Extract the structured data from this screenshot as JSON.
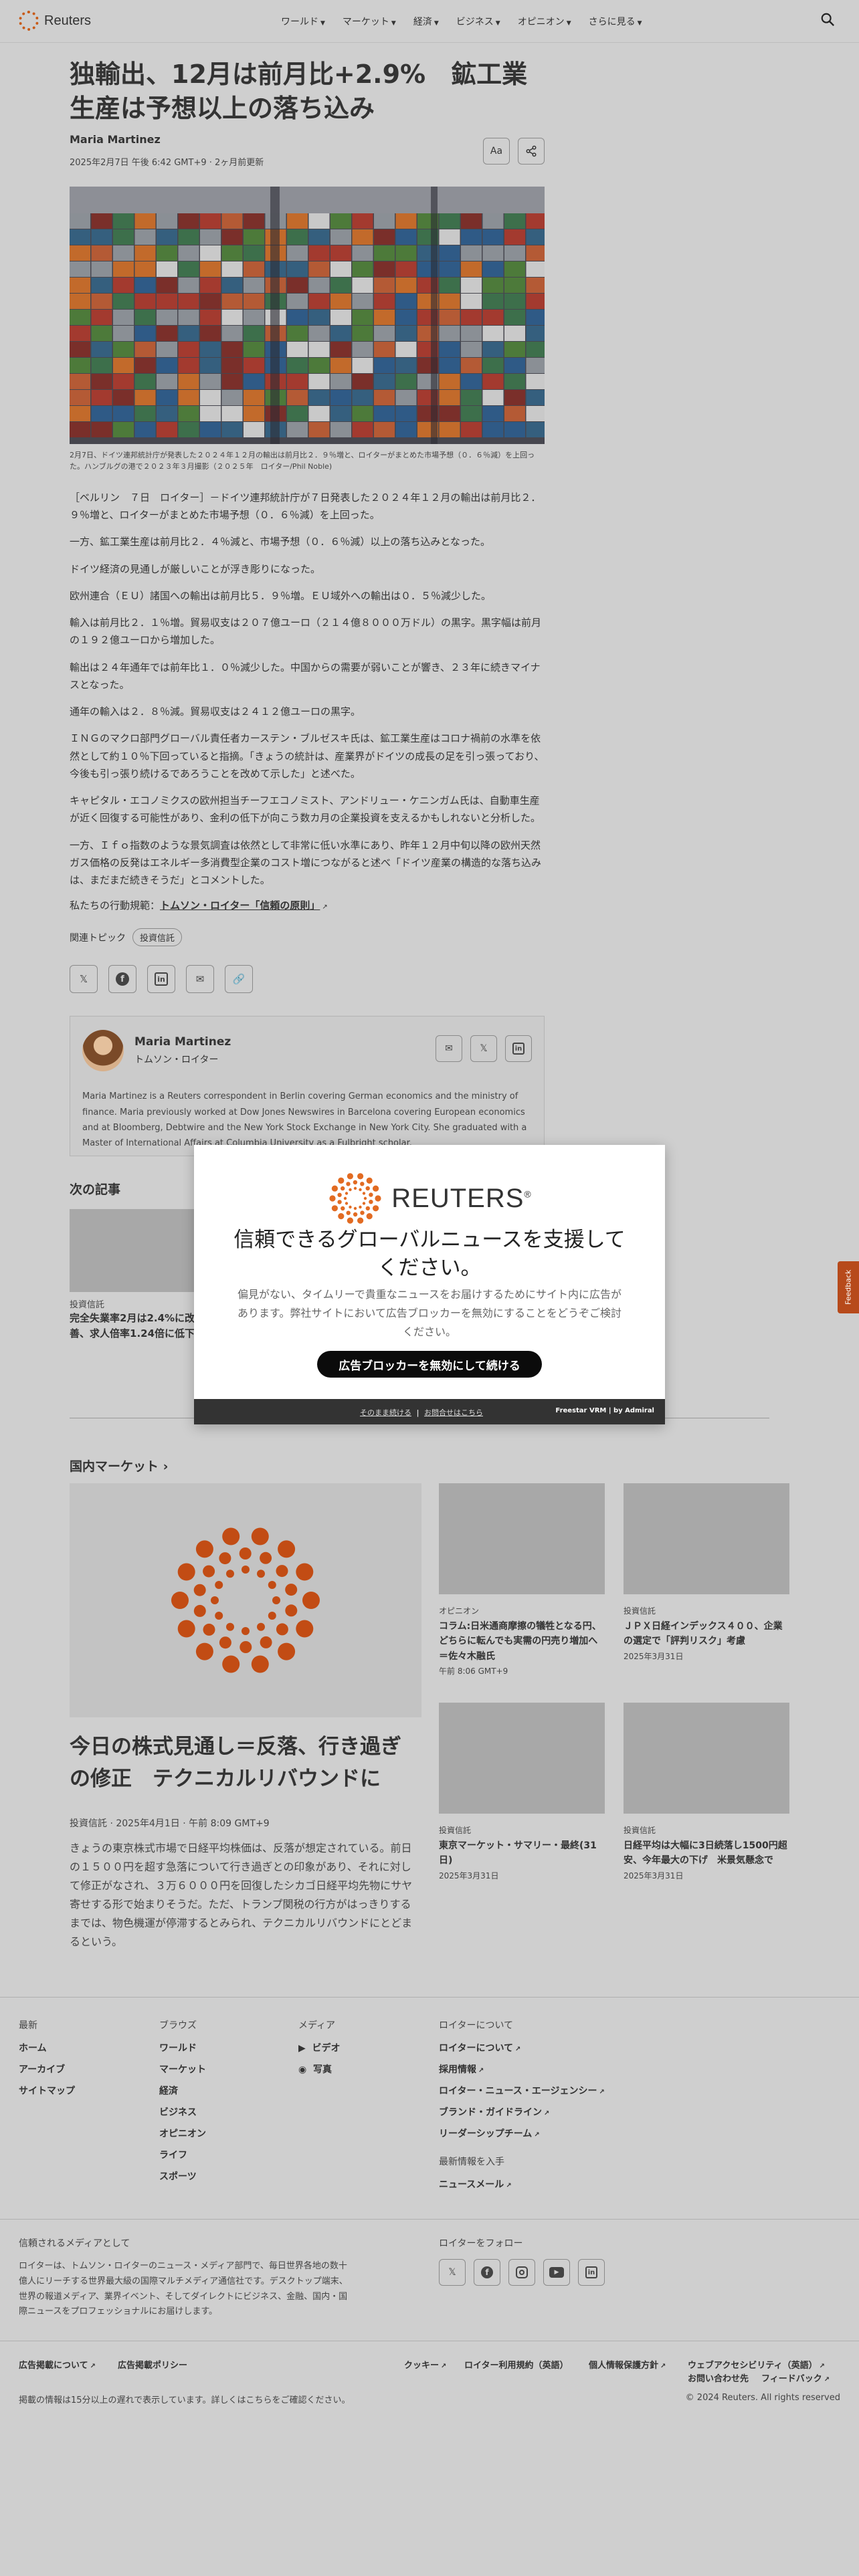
{
  "header": {
    "logo_text": "Reuters",
    "nav": [
      "ワールド",
      "マーケット",
      "経済",
      "ビジネス",
      "オピニオン",
      "さらに見る"
    ]
  },
  "article": {
    "headline": "独輸出、12月は前月比+2.9%　鉱工業生産は予想以上の落ち込み",
    "author": "Maria Martinez",
    "dateline": "2025年2月7日 午後 6:42 GMT+9 · 2ヶ月前更新",
    "text_size_label": "Aa",
    "caption": "2月7日、ドイツ連邦統計庁が発表した２０２４年１２月の輸出は前月比２．９％増と、ロイターがまとめた市場予想（０．６％減）を上回った。ハンブルグの港で２０２３年３月撮影（２０２５年　ロイター/Phil Noble)",
    "paragraphs": [
      "［ベルリン　７日　ロイター］－ドイツ連邦統計庁が７日発表した２０２４年１２月の輸出は前月比２．９％増と、ロイターがまとめた市場予想（０．６％減）を上回った。",
      "一方、鉱工業生産は前月比２．４％減と、市場予想（０．６％減）以上の落ち込みとなった。",
      "ドイツ経済の見通しが厳しいことが浮き彫りになった。",
      "欧州連合（ＥＵ）諸国への輸出は前月比５．９％増。ＥＵ域外への輸出は０．５％減少した。",
      "輸入は前月比２．１％増。貿易収支は２０７億ユーロ（２１４億８０００万ドル）の黒字。黒字幅は前月の１９２億ユーロから増加した。",
      "輸出は２４年通年では前年比１．０％減少した。中国からの需要が弱いことが響き、２３年に続きマイナスとなった。",
      "通年の輸入は２．８％減。貿易収支は２４１２億ユーロの黒字。",
      "ＩＮＧのマクロ部門グローバル責任者カーステン・ブルゼスキ氏は、鉱工業生産はコロナ禍前の水準を依然として約１０％下回っていると指摘。「きょうの統計は、産業界がドイツの成長の足を引っ張っており、今後も引っ張り続けるであろうことを改めて示した」と述べた。",
      "キャピタル・エコノミクスの欧州担当チーフエコノミスト、アンドリュー・ケニンガム氏は、自動車生産が近く回復する可能性があり、金利の低下が向こう数カ月の企業投資を支えるかもしれないと分析した。",
      "一方、Ｉｆｏ指数のような景気調査は依然として非常に低い水準にあり、昨年１２月中旬以降の欧州天然ガス価格の反発はエネルギー多消費型企業のコスト増につながると述べ「ドイツ産業の構造的な落ち込みは、まだまだ続きそうだ」とコメントした。"
    ],
    "principles_prefix": "私たちの行動規範：",
    "principles_link": "トムソン・ロイター「信頼の原則」",
    "topics_label": "関連トピック",
    "topic_chip": "投資信託",
    "author_card": {
      "name": "Maria Martinez",
      "org": "トムソン・ロイター",
      "bio": "Maria Martinez is a Reuters correspondent in Berlin covering German economics and the ministry of finance. Maria previously worked at Dow Jones Newswires in Barcelona covering European economics and at Bloomberg, Debtwire and the New York Stock Exchange in New York City. She graduated with a Master of International Affairs at Columbia University as a Fulbright scholar."
    }
  },
  "next_articles": {
    "title": "次の記事",
    "items": [
      {
        "category": "投資信託",
        "headline": "完全失業率2月は2.4%に改善、求人倍率1.24倍に低下"
      }
    ]
  },
  "domestic_markets": {
    "title": "国内マーケット",
    "main": {
      "headline": "今日の株式見通し＝反落、行き過ぎの修正　テクニカルリバウンドに",
      "meta": "投資信託 · 2025年4月1日 · 午前 8:09 GMT+9",
      "summary": "きょうの東京株式市場で日経平均株価は、反落が想定されている。前日の１５００円を超す急落について行き過ぎとの印象があり、それに対して修正がなされ、３万６０００円を回復したシカゴ日経平均先物にサヤ寄せする形で始まりそうだ。ただ、トランプ関税の行方がはっきりするまでは、物色機運が停滞するとみられ、テクニカルリバウンドにとどまるという。"
    },
    "cards": [
      {
        "category": "オピニオン",
        "title": "コラム:日米通商摩擦の犠牲となる円、どちらに転んでも実需の円売り増加へ＝佐々木融氏",
        "time": "午前 8:06 GMT+9"
      },
      {
        "category": "投資信託",
        "title": "ＪＰＸ日経インデックス４００、企業の選定で「評判リスク」考慮",
        "time": "2025年3月31日"
      },
      {
        "category": "投資信託",
        "title": "東京マーケット・サマリー・最終(31日)",
        "time": "2025年3月31日"
      },
      {
        "category": "投資信託",
        "title": "日経平均は大幅に3日続落し1500円超安、今年最大の下げ　米景気懸念で",
        "time": "2025年3月31日"
      }
    ]
  },
  "footer": {
    "columns": [
      {
        "heading": "最新",
        "items": [
          "ホーム",
          "アーカイブ",
          "サイトマップ"
        ]
      },
      {
        "heading": "ブラウズ",
        "items": [
          "ワールド",
          "マーケット",
          "経済",
          "ビジネス",
          "オピニオン",
          "ライフ",
          "スポーツ"
        ]
      },
      {
        "heading": "メディア",
        "items": [
          "ビデオ",
          "写真"
        ]
      },
      {
        "heading": "ロイターについて",
        "items": [
          "ロイターについて",
          "採用情報",
          "ロイター・ニュース・エージェンシー",
          "ブランド・ガイドライン",
          "リーダーシップチーム"
        ]
      }
    ],
    "newsletter_heading": "最新情報を入手",
    "newsletter_item": "ニュースメール",
    "trust_title": "信頼されるメディアとして",
    "trust_text": "ロイターは、トムソン・ロイターのニュース・メディア部門で、毎日世界各地の数十億人にリーチする世界最大級の国際マルチメディア通信社です。デスクトップ端末、世界の報道メディア、業界イベント、そしてダイレクトにビジネス、金融、国内・国際ニュースをプロフェッショナルにお届けします。",
    "follow_title": "ロイターをフォロー",
    "legal_left": [
      "広告掲載について",
      "広告掲載ポリシー"
    ],
    "legal_right": [
      "クッキー",
      "ロイター利用規約（英語）",
      "個人情報保護方針",
      "ウェブアクセシビリティ（英語）"
    ],
    "legal_right2": [
      "お問い合わせ先",
      "フィードバック"
    ],
    "note": "掲載の情報は15分以上の遅れで表示しています。詳しくはこちらをご確認ください。",
    "copyright": "© 2024 Reuters. All rights reserved"
  },
  "feedback_label": "Feedback",
  "modal": {
    "logo_text": "REUTERS",
    "headline": "信頼できるグローバルニュースを支援してください。",
    "body": "偏見がない、タイムリーで貴重なニュースをお届けするためにサイト内に広告があります。弊社サイトにおいて広告ブロッカーを無効にすることをどうぞご検討ください。",
    "button": "広告ブロッカーを無効にして続ける",
    "link_continue": "そのまま続ける",
    "link_sep": "|",
    "link_contact": "お問合せはこちら",
    "brand": "Freestar VRM | by Admiral"
  },
  "colors": {
    "accent": "#e26b22",
    "modal_button": "#0b0b0b"
  }
}
